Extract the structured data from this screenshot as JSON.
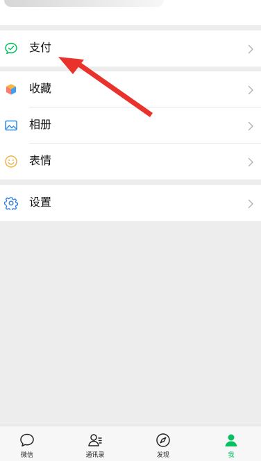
{
  "menu": {
    "pay_label": "支付",
    "favorites_label": "收藏",
    "album_label": "相册",
    "stickers_label": "表情",
    "settings_label": "设置"
  },
  "tabbar": {
    "chats_label": "微信",
    "contacts_label": "通讯录",
    "discover_label": "发现",
    "me_label": "我"
  },
  "colors": {
    "accent": "#07c160",
    "background": "#ededed",
    "annotation_arrow": "#e8322b"
  },
  "icons": {
    "pay": "pay-icon",
    "favorites": "favorites-cube-icon",
    "album": "photo-album-icon",
    "stickers": "smiley-icon",
    "settings": "gear-icon",
    "chats": "chat-bubble-icon",
    "contacts": "contacts-icon",
    "discover": "compass-icon",
    "me": "person-icon"
  }
}
